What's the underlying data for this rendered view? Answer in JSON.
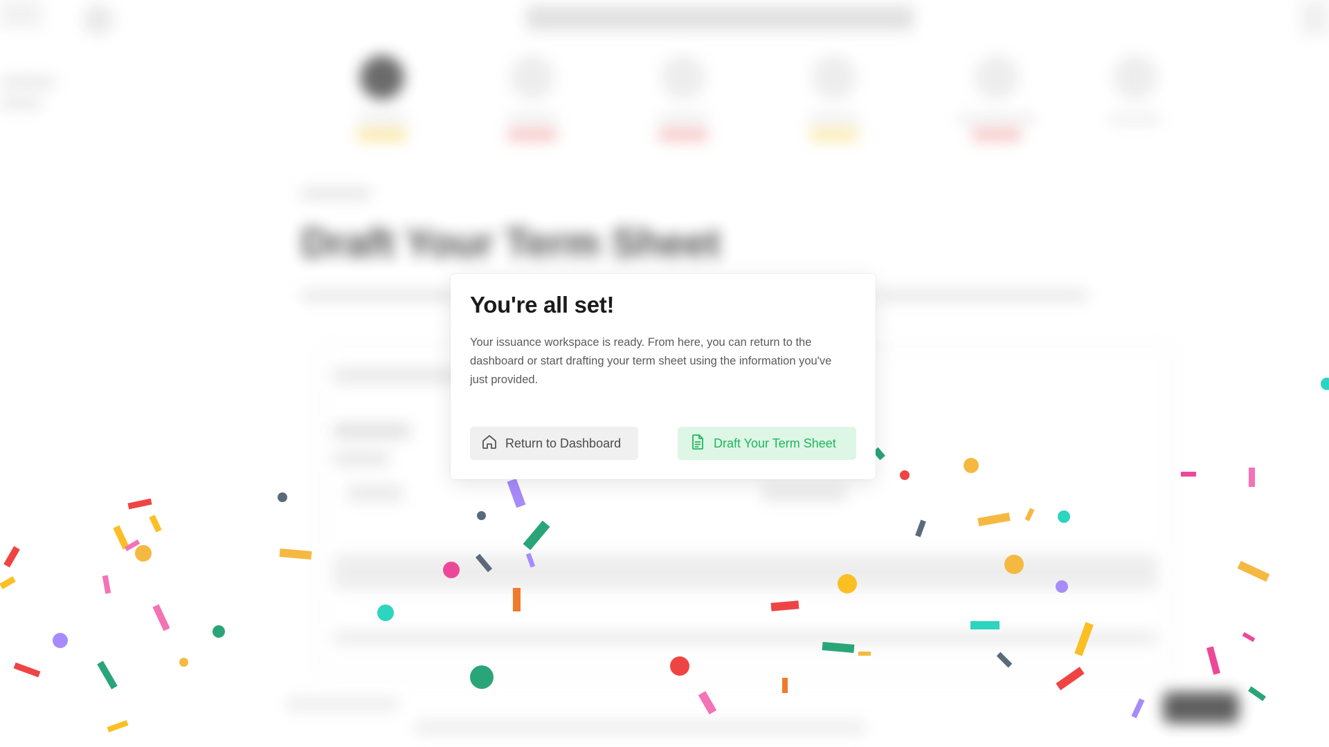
{
  "background": {
    "page_heading": "Draft Your Term Sheet"
  },
  "modal": {
    "title": "You're all set!",
    "body": "Your issuance workspace is ready. From here, you can return to the dashboard or start drafting your term sheet using the information you've just provided.",
    "buttons": {
      "return_dashboard": {
        "label": "Return to Dashboard",
        "icon": "home-icon"
      },
      "draft_term_sheet": {
        "label": "Draft Your Term Sheet",
        "icon": "document-icon"
      }
    }
  },
  "colors": {
    "draft_button_bg": "#ddf6e6",
    "draft_button_text": "#1fb65b",
    "dashboard_button_bg": "#f0f0f0",
    "confetti": [
      "#ef4444",
      "#f5b941",
      "#2aa57a",
      "#5a6a7a",
      "#a78bfa",
      "#f472b6",
      "#2dd4bf",
      "#fbbf24",
      "#f07a2a",
      "#ec4899"
    ]
  }
}
